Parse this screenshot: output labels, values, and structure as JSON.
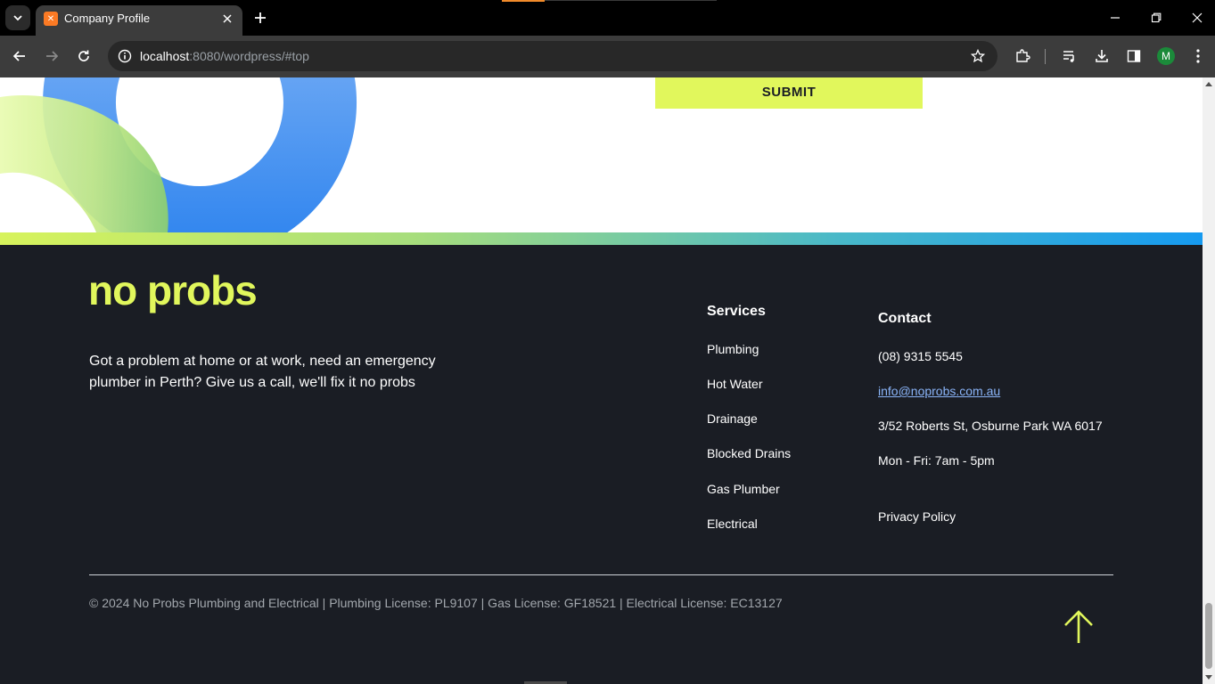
{
  "browser": {
    "tab_title": "Company Profile",
    "favicon_letter": "✕",
    "url_host": "localhost",
    "url_rest": ":8080/wordpress/#top",
    "profile_initial": "M"
  },
  "page": {
    "submit_label": "SUBMIT",
    "logo_text": "no probs",
    "tagline": "Got a problem at home or at work, need an emergency plumber in Perth? Give us a call, we'll fix it no probs",
    "services": {
      "heading": "Services",
      "items": [
        "Plumbing",
        "Hot Water",
        "Drainage",
        "Blocked Drains",
        "Gas Plumber",
        "Electrical"
      ]
    },
    "contact": {
      "heading": "Contact",
      "phone": "(08) 9315 5545",
      "email": "info@noprobs.com.au",
      "address": "3/52 Roberts St, Osburne Park WA 6017",
      "hours": "Mon - Fri: 7am - 5pm",
      "privacy": "Privacy Policy"
    },
    "copyright": "© 2024 No Probs Plumbing and Electrical | Plumbing License: PL9107 | Gas License: GF18521 | Electrical License: EC13127"
  },
  "colors": {
    "accent_lime": "#e1f75c",
    "footer_bg": "#1a1d24",
    "blue": "#2d86f0"
  }
}
